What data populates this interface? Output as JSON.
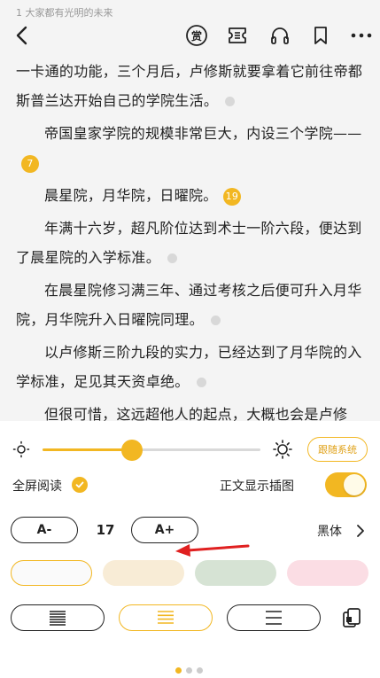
{
  "header": {
    "breadcrumb": "1 大家都有光明的未来",
    "icons": [
      "back-icon",
      "reward-icon",
      "ticket-icon",
      "headphones-icon",
      "bookmark-icon",
      "more-icon"
    ],
    "reward_glyph": "赏"
  },
  "content": {
    "paragraphs": [
      {
        "text": "一卡通的功能，三个月后，卢修斯就要拿着它前往帝都斯普兰达开始自己的学院生活。",
        "indent": false,
        "comment": ""
      },
      {
        "text": "帝国皇家学院的规模非常巨大，内设三个学院——",
        "indent": true,
        "comment": "7"
      },
      {
        "text": "晨星院，月华院，日曜院。",
        "indent": true,
        "comment": "19"
      },
      {
        "text": "年满十六岁，超凡阶位达到术士一阶六段，便达到了晨星院的入学标准。",
        "indent": true,
        "comment": ""
      },
      {
        "text": "在晨星院修习满三年、通过考核之后便可升入月华院，月华院升入日曜院同理。",
        "indent": true,
        "comment": ""
      },
      {
        "text": "以卢修斯三阶九段的实力，已经达到了月华院的入学标准，足见其天资卓绝。",
        "indent": true,
        "comment": ""
      },
      {
        "text": "但很可惜，这远超他人的起点，大概也会是卢修",
        "indent": true,
        "comment": ""
      }
    ]
  },
  "settings": {
    "brightness": {
      "value": 0.41,
      "follow_system_label": "跟随系统"
    },
    "fullscreen": {
      "label": "全屏阅读",
      "checked": true
    },
    "show_images": {
      "label": "正文显示插图",
      "on": true
    },
    "font_size": {
      "decrease_label": "A-",
      "value": "17",
      "increase_label": "A+"
    },
    "font_family": {
      "value": "黑体"
    },
    "themes": [
      {
        "name": "white",
        "color": "#fafafa",
        "selected": true
      },
      {
        "name": "cream",
        "color": "#f8ecd6",
        "selected": false
      },
      {
        "name": "green",
        "color": "#d6e3d4",
        "selected": false
      },
      {
        "name": "pink",
        "color": "#fbdde4",
        "selected": false
      }
    ],
    "line_spacing": {
      "options": [
        "compact",
        "standard",
        "loose"
      ],
      "selected": 1
    },
    "page_turn_icon": "page-flip-icon",
    "pager": {
      "count": 3,
      "active": 0
    }
  },
  "colors": {
    "accent": "#f2b722",
    "arrow": "#e02020"
  }
}
